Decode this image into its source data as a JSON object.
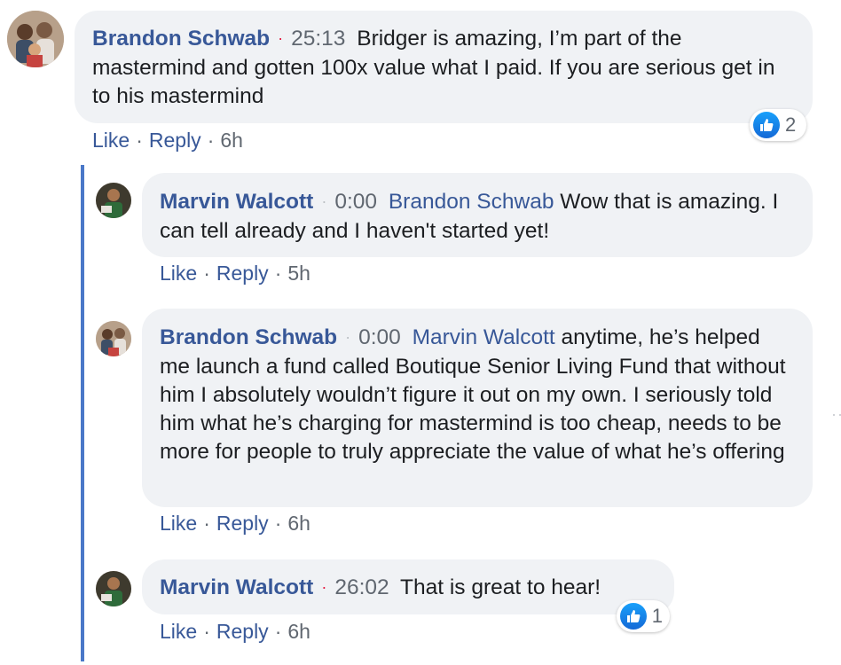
{
  "comments": [
    {
      "author": "Brandon Schwab",
      "time": "25:13",
      "mention": "",
      "text": "Bridger is amazing, I’m part of the mastermind and gotten 100x value what I paid. If you are serious get in to his mastermind",
      "like": "Like",
      "reply": "Reply",
      "age": "6h",
      "reactions": "2"
    },
    {
      "author": "Marvin Walcott",
      "time": "0:00",
      "mention": "Brandon Schwab",
      "text": "Wow that is amazing. I can tell already and I haven't started yet!",
      "like": "Like",
      "reply": "Reply",
      "age": "5h"
    },
    {
      "author": "Brandon Schwab",
      "time": "0:00",
      "mention": "Marvin Walcott",
      "text": "anytime, he’s helped me launch a fund called Boutique Senior Living Fund that without him I absolutely wouldn’t figure it out on my own. I seriously told him what he’s charging for mastermind is too cheap, needs to be more for people to truly appreciate the value of what he’s offering",
      "like": "Like",
      "reply": "Reply",
      "age": "6h"
    },
    {
      "author": "Marvin Walcott",
      "time": "26:02",
      "mention": "",
      "text": "That is great to hear!",
      "like": "Like",
      "reply": "Reply",
      "age": "6h",
      "reactions": "1"
    }
  ],
  "separators": {
    "dot": "·"
  },
  "icons": {
    "reaction": "like-thumbs-up-icon",
    "overflow": "more-dots-icon"
  },
  "colors": {
    "link": "#385898",
    "bubble": "#f0f2f5",
    "timestamp_dot": "#e4173e",
    "thread_line": "#4a78c8",
    "like_badge": "#1877f2"
  }
}
